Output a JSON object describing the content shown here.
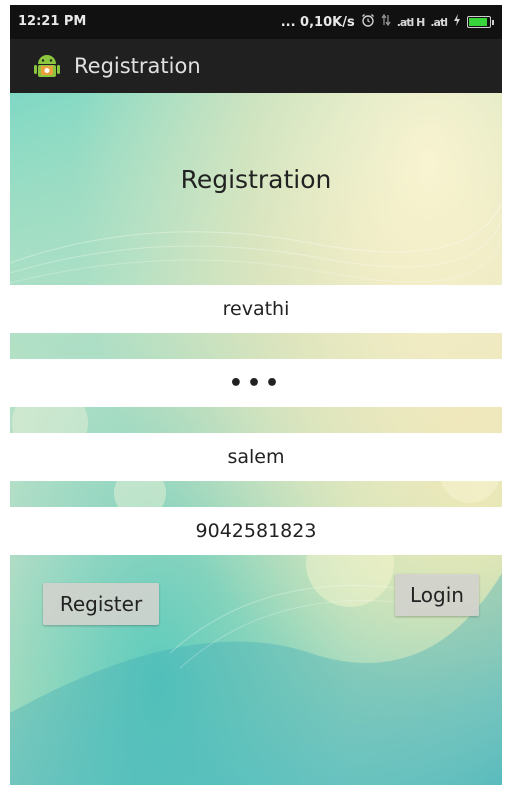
{
  "status_bar": {
    "time": "12:21 PM",
    "network_speed": "... 0,10K/s",
    "alarm_icon": "alarm-clock-icon",
    "signal_1": ".atl H",
    "signal_2": ".atl",
    "battery_icon": "battery-charging-icon"
  },
  "action_bar": {
    "app_icon": "android-icon",
    "title": "Registration"
  },
  "form": {
    "title": "Registration",
    "username_value": "revathi",
    "password_value": "•••",
    "city_value": "salem",
    "phone_value": "9042581823",
    "register_label": "Register",
    "login_label": "Login"
  },
  "colors": {
    "action_bar_bg": "#202020",
    "status_bar_bg": "#111111",
    "battery_fill": "#39d33b",
    "field_bg": "#ffffff"
  }
}
